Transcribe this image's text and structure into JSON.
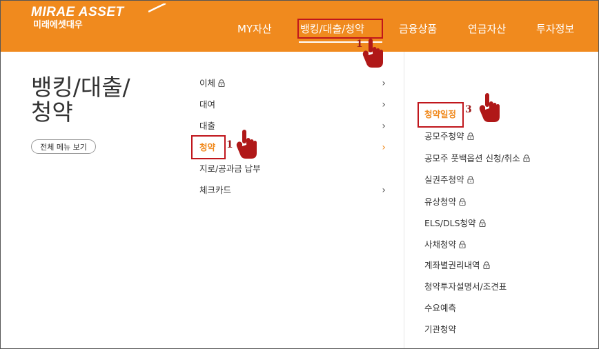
{
  "header": {
    "logo_main": "MIRAE ASSET",
    "logo_sub": "미래에셋대우",
    "nav": [
      {
        "label": "MY자산"
      },
      {
        "label": "뱅킹/대출/청약"
      },
      {
        "label": "금융상품"
      },
      {
        "label": "연금자산"
      },
      {
        "label": "투자정보"
      }
    ],
    "accent_color": "#f08a1e"
  },
  "page": {
    "title_line1": "뱅킹/대출/",
    "title_line2": "청약",
    "all_menu_label": "전체 메뉴 보기"
  },
  "menu": {
    "items": [
      {
        "label": "이체",
        "locked": true,
        "has_chevron": true
      },
      {
        "label": "대여",
        "locked": false,
        "has_chevron": true
      },
      {
        "label": "대출",
        "locked": false,
        "has_chevron": true
      },
      {
        "label": "청약",
        "locked": false,
        "has_chevron": true,
        "active": true
      },
      {
        "label": "지로/공과금 납부",
        "locked": false,
        "has_chevron": false
      },
      {
        "label": "체크카드",
        "locked": false,
        "has_chevron": true
      }
    ]
  },
  "submenu": {
    "items": [
      {
        "label": "청약일정",
        "active": true
      },
      {
        "label": "공모주청약",
        "locked": true
      },
      {
        "label": "공모주 풋백옵션 신청/취소",
        "locked": true
      },
      {
        "label": "실권주청약",
        "locked": true
      },
      {
        "label": "유상청약",
        "locked": true
      },
      {
        "label": "ELS/DLS청약",
        "locked": true
      },
      {
        "label": "사채청약",
        "locked": true
      },
      {
        "label": "계좌별권리내역",
        "locked": true
      },
      {
        "label": "청약투자설명서/조견표",
        "locked": false
      },
      {
        "label": "수요예측",
        "locked": false
      },
      {
        "label": "기관청약",
        "locked": false
      }
    ]
  },
  "annotations": {
    "step_nav": "1",
    "step_menu": "1",
    "step_sub": "3",
    "highlight_color": "#c0161c",
    "hand_color": "#b01818"
  }
}
